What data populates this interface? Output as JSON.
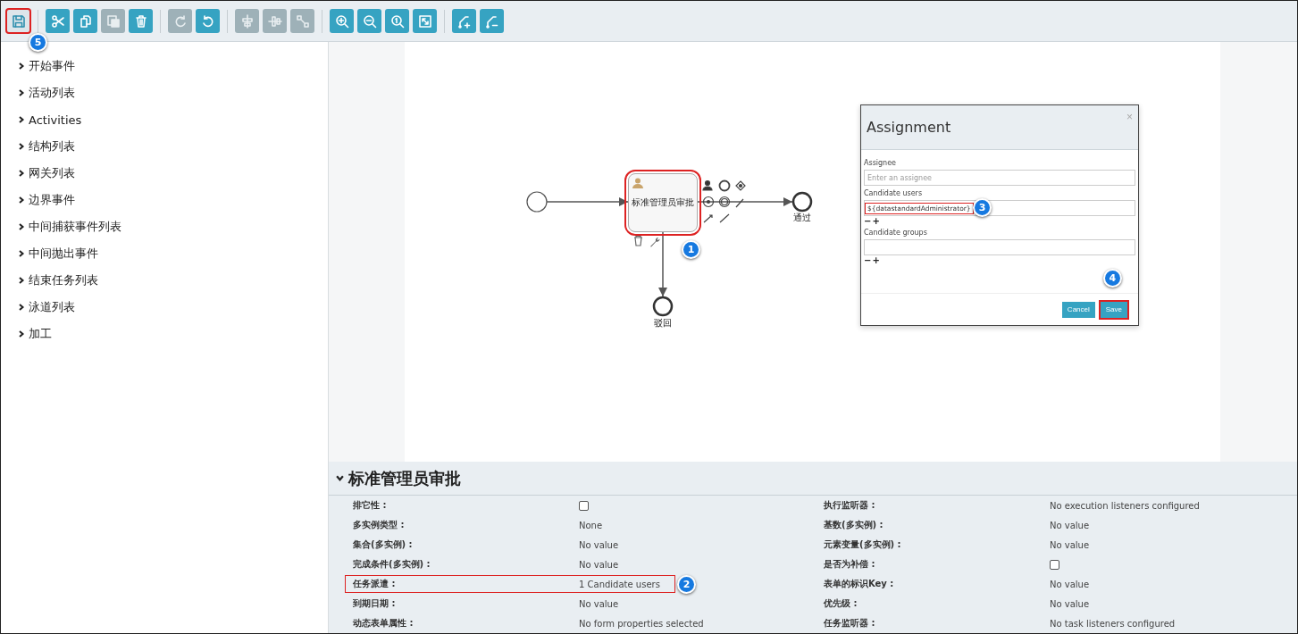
{
  "toolbar": {
    "groups": [
      [
        {
          "kind": "save",
          "disabled": false,
          "highlighted": true,
          "callout": "5"
        }
      ],
      [
        {
          "kind": "cut",
          "disabled": false,
          "highlighted": false
        },
        {
          "kind": "copy",
          "disabled": false,
          "highlighted": false
        },
        {
          "kind": "paste",
          "disabled": true,
          "highlighted": false
        },
        {
          "kind": "delete",
          "disabled": false,
          "highlighted": false
        }
      ],
      [
        {
          "kind": "redo",
          "disabled": true,
          "highlighted": false
        },
        {
          "kind": "undo",
          "disabled": false,
          "highlighted": false
        }
      ],
      [
        {
          "kind": "align-horizontal",
          "disabled": true,
          "highlighted": false
        },
        {
          "kind": "align-vertical",
          "disabled": true,
          "highlighted": false
        },
        {
          "kind": "same-size",
          "disabled": true,
          "highlighted": false
        }
      ],
      [
        {
          "kind": "zoom-in",
          "disabled": false,
          "highlighted": false
        },
        {
          "kind": "zoom-out",
          "disabled": false,
          "highlighted": false
        },
        {
          "kind": "zoom-actual",
          "disabled": false,
          "highlighted": false
        },
        {
          "kind": "zoom-fit",
          "disabled": false,
          "highlighted": false
        }
      ],
      [
        {
          "kind": "bendpoint-add",
          "disabled": false,
          "highlighted": false
        },
        {
          "kind": "bendpoint-remove",
          "disabled": false,
          "highlighted": false
        }
      ]
    ]
  },
  "palette": {
    "items": [
      {
        "label": "开始事件",
        "expanded": false
      },
      {
        "label": "活动列表",
        "expanded": false
      },
      {
        "label": "Activities",
        "expanded": false
      },
      {
        "label": "结构列表",
        "expanded": false
      },
      {
        "label": "网关列表",
        "expanded": false
      },
      {
        "label": "边界事件",
        "expanded": false
      },
      {
        "label": "中间捕获事件列表",
        "expanded": false
      },
      {
        "label": "中间抛出事件",
        "expanded": false
      },
      {
        "label": "结束任务列表",
        "expanded": false
      },
      {
        "label": "泳道列表",
        "expanded": false
      },
      {
        "label": "加工",
        "expanded": false
      }
    ]
  },
  "diagram": {
    "task": {
      "label": "标准管理员审批",
      "highlighted": true,
      "callout": "1"
    },
    "end_events": [
      {
        "label": "通过"
      },
      {
        "label": "驳回"
      }
    ]
  },
  "dialog": {
    "title": "Assignment",
    "close": "×",
    "fields": [
      {
        "label": "Assignee",
        "placeholder": "Enter an assignee"
      },
      {
        "label": "Candidate users",
        "value": "${datastandardAdministrator}",
        "highlighted": true,
        "callout": "3",
        "controls": [
          "−",
          "+"
        ]
      },
      {
        "label": "Candidate groups",
        "controls": [
          "−",
          "+"
        ]
      }
    ],
    "buttons": [
      {
        "label": "Cancel",
        "highlighted": false
      },
      {
        "label": "Save",
        "highlighted": true,
        "callout": "4"
      }
    ]
  },
  "properties": {
    "title": "标准管理员审批",
    "expanded": true,
    "rows": [
      {
        "highlighted": false,
        "left": {
          "label": "排它性 :",
          "kind": "checkbox",
          "checked": false
        },
        "right": {
          "label": "执行监听器 :",
          "kind": "text",
          "value": "No execution listeners configured"
        }
      },
      {
        "highlighted": false,
        "left": {
          "label": "多实例类型 :",
          "kind": "text",
          "value": "None"
        },
        "right": {
          "label": "基数(多实例) :",
          "kind": "text",
          "value": "No value"
        }
      },
      {
        "highlighted": false,
        "left": {
          "label": "集合(多实例) :",
          "kind": "text",
          "value": "No value"
        },
        "right": {
          "label": "元素变量(多实例) :",
          "kind": "text",
          "value": "No value"
        }
      },
      {
        "highlighted": false,
        "left": {
          "label": "完成条件(多实例) :",
          "kind": "text",
          "value": "No value"
        },
        "right": {
          "label": "是否为补偿 :",
          "kind": "checkbox",
          "checked": false
        }
      },
      {
        "highlighted": true,
        "callout": "2",
        "left": {
          "label": "任务派遣 :",
          "kind": "text",
          "value": "1 Candidate users"
        },
        "right": {
          "label": "表单的标识Key :",
          "kind": "text",
          "value": "No value"
        }
      },
      {
        "highlighted": false,
        "left": {
          "label": "到期日期 :",
          "kind": "text",
          "value": "No value"
        },
        "right": {
          "label": "优先级 :",
          "kind": "text",
          "value": "No value"
        }
      },
      {
        "highlighted": false,
        "left": {
          "label": "动态表单属性 :",
          "kind": "text",
          "value": "No form properties selected"
        },
        "right": {
          "label": "任务监听器 :",
          "kind": "text",
          "value": "No task listeners configured"
        }
      }
    ]
  }
}
